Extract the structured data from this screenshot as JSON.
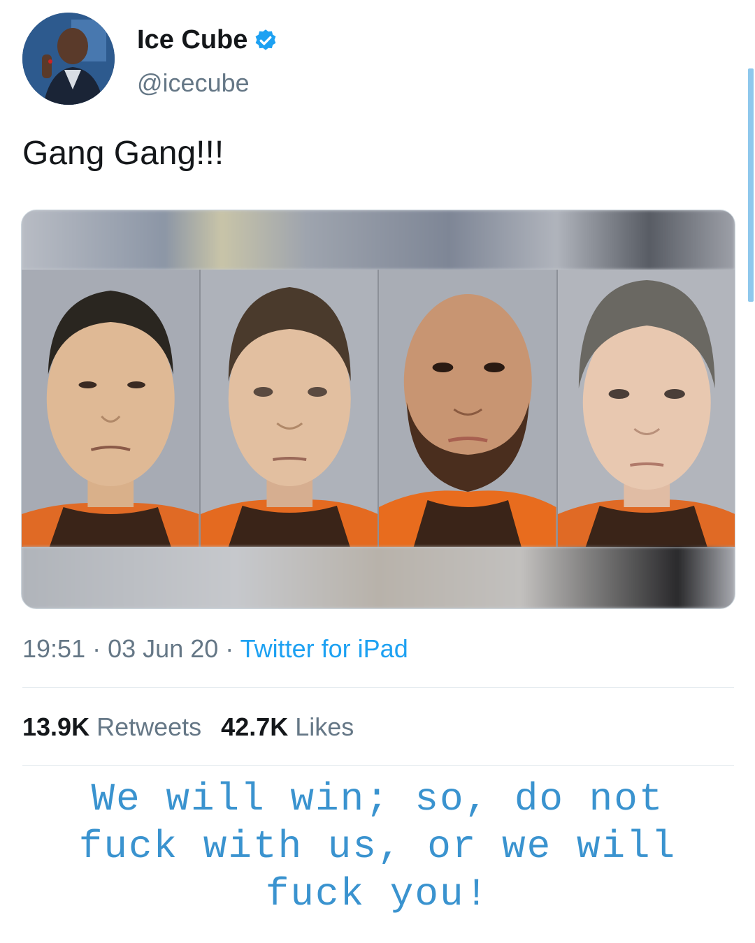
{
  "tweet": {
    "author_name": "Ice Cube",
    "handle": "@icecube",
    "verified": true,
    "text": "Gang Gang!!!",
    "time": "19:51",
    "separator": "·",
    "date": "03 Jun 20",
    "source": "Twitter for iPad"
  },
  "stats": {
    "retweets_count": "13.9K",
    "retweets_label": "Retweets",
    "likes_count": "42.7K",
    "likes_label": "Likes"
  },
  "caption": {
    "line1": "We will win; so, do not",
    "line2": "fuck with us, or we will",
    "line3": "fuck you!"
  },
  "colors": {
    "accent": "#1da1f2",
    "caption": "#3a93cf",
    "muted": "#657786"
  },
  "icons": {
    "verified": "verified-badge-icon"
  }
}
